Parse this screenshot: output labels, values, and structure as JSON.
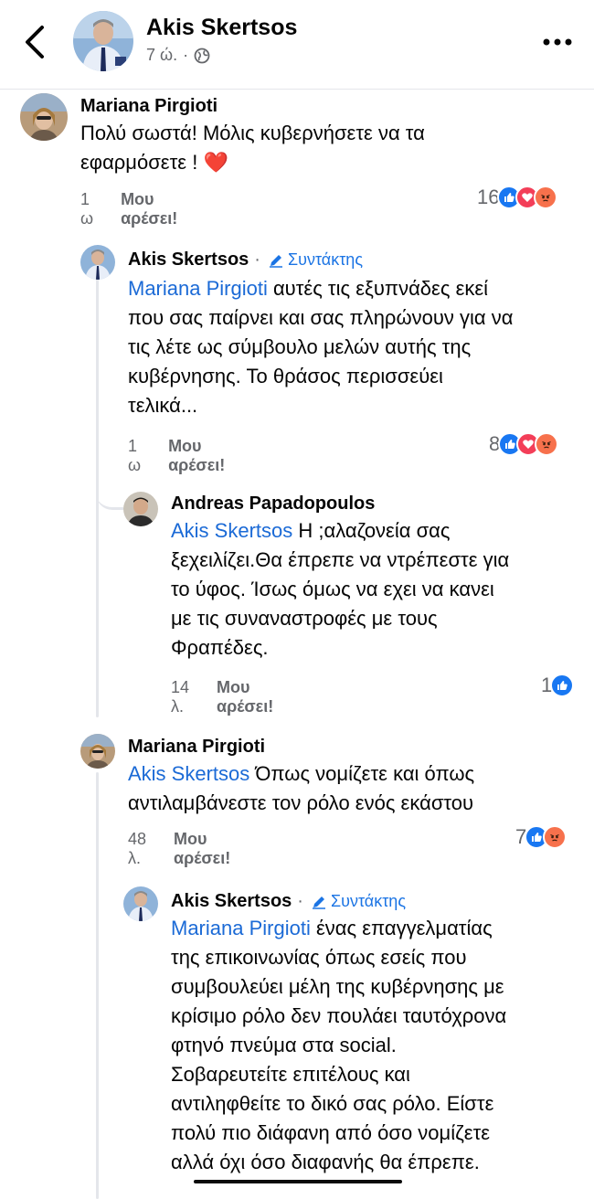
{
  "header": {
    "name": "Akis Skertsos",
    "time": "7 ώ.",
    "separator": "·"
  },
  "comments": [
    {
      "author": "Mariana Pirgioti",
      "text": "Πολύ σωστά! Μόλις κυβερνήσετε να τα εφαρμόσετε ! ❤️",
      "line1": "Πολύ σωστά! Μόλις κυβερνήσετε να τα",
      "line2": "εφαρμόσετε ! ❤️",
      "time": "1 ω",
      "like_label": "Μου αρέσει!",
      "reaction_count": "16"
    },
    {
      "author": "Akis Skertsos",
      "badge": "Συντάκτης",
      "dot": "·",
      "mention": "Mariana Pirgioti",
      "lines": [
        " αυτές τις εξυπνάδες εκεί",
        "που σας παίρνει και σας πληρώνουν για να",
        "τις λέτε ως σύμβουλο μελών αυτής της",
        "κυβέρνησης. Το θράσος περισσεύει",
        "τελικά..."
      ],
      "time": "1 ω",
      "like_label": "Μου αρέσει!",
      "reaction_count": "8"
    },
    {
      "author": "Andreas Papadopoulos",
      "mention": "Akis Skertsos",
      "lines": [
        " Η ;αλαζονεία σας",
        "ξεχειλίζει.Θα έπρεπε να ντρέπεστε για",
        "το ύφος. Ίσως όμως να εχει να κανει",
        "με τις συναναστροφές με τους",
        "Φραπέδες."
      ],
      "time": "14 λ.",
      "like_label": "Μου αρέσει!",
      "reaction_count": "1"
    },
    {
      "author": "Mariana Pirgioti",
      "mention": "Akis Skertsos",
      "lines": [
        " Όπως νομίζετε και όπως",
        "αντιλαμβάνεστε τον ρόλο ενός εκάστου"
      ],
      "time": "48 λ.",
      "like_label": "Μου αρέσει!",
      "reaction_count": "7"
    },
    {
      "author": "Akis Skertsos",
      "badge": "Συντάκτης",
      "dot": "·",
      "mention": "Mariana Pirgioti",
      "lines": [
        " ένας επαγγελματίας",
        "της επικοινωνίας όπως εσείς που",
        "συμβουλεύει μέλη της κυβέρνησης με",
        "κρίσιμο ρόλο δεν πουλάει ταυτόχρονα",
        "φτηνό πνεύμα στα social.",
        "Σοβαρευτείτε επιτέλους και",
        "αντιληφθείτε το δικό σας ρόλο. Είστε",
        "πολύ πιο διάφανη από όσο νομίζετε",
        "αλλά όχι όσο διαφανής θα έπρεπε."
      ]
    }
  ],
  "colors": {
    "mention": "#1b6ad6",
    "meta": "#65676b",
    "like": "#1877f2",
    "love": "#f33e58",
    "angry": "#f7714c",
    "thread": "#e4e6eb"
  },
  "icons": [
    "back-chevron-icon",
    "globe-icon",
    "more-dots-icon",
    "pencil-icon",
    "like-reaction-icon",
    "love-reaction-icon",
    "angry-reaction-icon"
  ]
}
